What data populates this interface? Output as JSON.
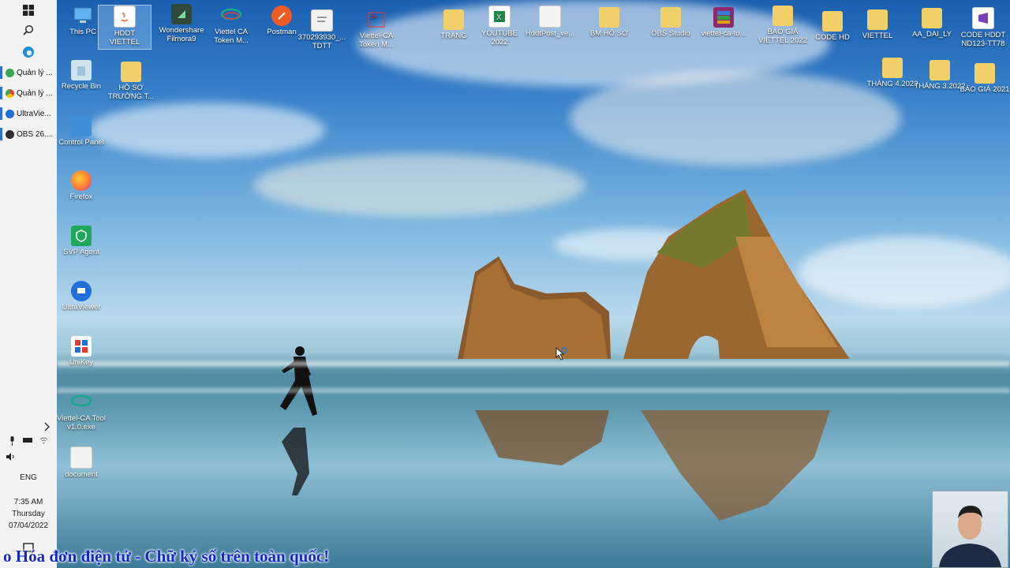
{
  "taskbar": {
    "apps": [
      {
        "label": "Quản lý ...",
        "color": "#34a853"
      },
      {
        "label": "Quản lý ...",
        "color": "#ea4335"
      },
      {
        "label": "UltraVie...",
        "color": "#1e6fd9"
      },
      {
        "label": "OBS 26....",
        "color": "#302e31"
      }
    ],
    "language": "ENG",
    "clock": {
      "time": "7:35 AM",
      "day": "Thursday",
      "date": "07/04/2022"
    }
  },
  "desktop_icons": [
    {
      "label": "This PC",
      "icon": "computer-icon",
      "color": "#5fb2ee"
    },
    {
      "label": "HDDT VIETTEL",
      "icon": "folder-icon",
      "color": "#f1d06a"
    },
    {
      "label": "Wondershare Filmora9",
      "icon": "filmora-icon",
      "color": "#2f4a3c"
    },
    {
      "label": "Viettel CA Token M...",
      "icon": "viettel-ca-icon",
      "color": "#19a78a"
    },
    {
      "label": "Postman",
      "icon": "postman-icon",
      "color": "#ef5b25"
    },
    {
      "label": "370293930_... TDTT",
      "icon": "document-icon",
      "color": "#f2f2f2"
    },
    {
      "label": "Viettel-CA Token M...",
      "icon": "shortcut-icon",
      "color": "#e53935"
    },
    {
      "label": "TRANG",
      "icon": "folder-icon",
      "color": "#f1d06a"
    },
    {
      "label": "YOUTUBE 2022",
      "icon": "excel-icon",
      "color": "#1f8a47"
    },
    {
      "label": "HddtPost_ve...",
      "icon": "text-file-icon",
      "color": "#f4f4f4"
    },
    {
      "label": "BM HỒ SƠ",
      "icon": "folder-icon",
      "color": "#f1d06a"
    },
    {
      "label": "OBS Studio",
      "icon": "folder-icon",
      "color": "#f1d06a"
    },
    {
      "label": "viettel-ca-to...",
      "icon": "winrar-icon",
      "color": "#8b2a6e"
    },
    {
      "label": "BÁO GIÁ VIETTEL 2022",
      "icon": "folder-icon",
      "color": "#f1d06a"
    },
    {
      "label": "CODE HD",
      "icon": "folder-icon",
      "color": "#f1d06a"
    },
    {
      "label": "VIETTEL",
      "icon": "folder-icon",
      "color": "#f1d06a"
    },
    {
      "label": "AA_DAI_LY",
      "icon": "folder-icon",
      "color": "#f1d06a"
    },
    {
      "label": "CODE HDDT ND123-TT78",
      "icon": "vs-icon",
      "color": "#7a3fb5"
    },
    {
      "label": "Recycle Bin",
      "icon": "recycle-bin-icon",
      "color": "#cfe3ee"
    },
    {
      "label": "HỒ SƠ TRƯỜNG T...",
      "icon": "folder-icon",
      "color": "#f1d06a"
    },
    {
      "label": "THÁNG 4.2022",
      "icon": "folder-icon",
      "color": "#f1d06a"
    },
    {
      "label": "THÁNG 3.2022",
      "icon": "folder-icon",
      "color": "#f1d06a"
    },
    {
      "label": "BÁO GIÁ 2021",
      "icon": "folder-icon",
      "color": "#f1d06a"
    },
    {
      "label": "Control Panel",
      "icon": "control-panel-icon",
      "color": "#3f8fd6"
    },
    {
      "label": "Firefox",
      "icon": "firefox-icon",
      "color": "#ff7139"
    },
    {
      "label": "SVP Agent",
      "icon": "svp-agent-icon",
      "color": "#1fa85a"
    },
    {
      "label": "UltraViewer",
      "icon": "ultraviewer-icon",
      "color": "#1e6fd9"
    },
    {
      "label": "UniKey",
      "icon": "unikey-icon",
      "color": "#e53935"
    },
    {
      "label": "Viettel-CA Tool v1.0.exe",
      "icon": "viettel-ca-icon",
      "color": "#19a78a"
    },
    {
      "label": "document",
      "icon": "document-icon",
      "color": "#f2f2f2"
    }
  ],
  "banner": {
    "text": "o Hóa đơn điện tử - Chữ ký số trên toàn quốc!"
  }
}
